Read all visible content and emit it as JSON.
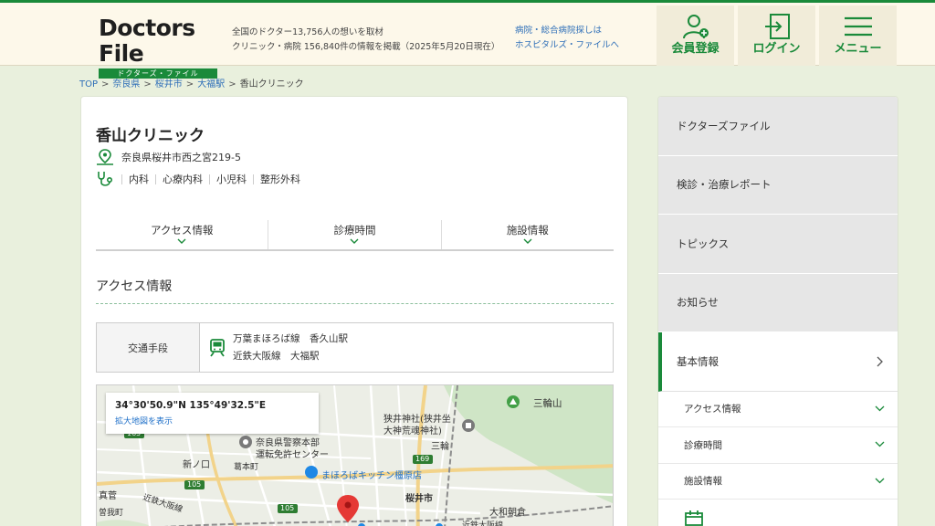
{
  "header": {
    "logo_main": "Doctors File",
    "logo_sub": "ドクターズ・ファイル",
    "tagline_1": "全国のドクター13,756人の想いを取材",
    "tagline_2": "クリニック・病院 156,840件の情報を掲載（2025年5月20日現在）",
    "hosp_link_1": "病院・総合病院探しは",
    "hosp_link_2": "ホスピタルズ・ファイルへ",
    "buttons": {
      "register": "会員登録",
      "login": "ログイン",
      "menu": "メニュー"
    }
  },
  "breadcrumb": {
    "items": [
      "TOP",
      "奈良県",
      "桜井市",
      "大福駅"
    ],
    "current": "香山クリニック",
    "sep": ">"
  },
  "clinic": {
    "name": "香山クリニック",
    "address": "奈良県桜井市西之宮219-5",
    "departments": [
      "内科",
      "心療内科",
      "小児科",
      "整形外科"
    ]
  },
  "tabs": [
    "アクセス情報",
    "診療時間",
    "施設情報"
  ],
  "access": {
    "title": "アクセス情報",
    "transport_label": "交通手段",
    "lines": [
      "万葉まほろば線　香久山駅",
      "近鉄大阪線　大福駅"
    ]
  },
  "map": {
    "coords": "34°30'50.9\"N 135°49'32.5\"E",
    "link": "拡大地図を表示",
    "labels": {
      "miwayama": "三輪山",
      "shrine_1": "狭井神社(狭井坐",
      "shrine_2": "大神荒魂神社)",
      "miwa": "三輪",
      "police_1": "奈良県警察本部",
      "police_2": "運転免許センター",
      "shinnokuchi": "新ノ口",
      "kuzumoto": "葛本町",
      "kitchen": "まほろばキッチン橿原店",
      "sakurai": "桜井市",
      "yamato_asakura": "大和朝倉",
      "kintetsu_1": "近鉄大阪線",
      "kintetsu_2": "近鉄大阪線",
      "masuga": "真菅",
      "soga": "曽我町",
      "r105a": "105",
      "r105b": "105",
      "r169": "169",
      "r165": "165"
    }
  },
  "sidebar": {
    "items": [
      "ドクターズファイル",
      "検診・治療レポート",
      "トピックス",
      "お知らせ",
      "基本情報"
    ],
    "sub_items": [
      "アクセス情報",
      "診療時間",
      "施設情報"
    ]
  },
  "colors": {
    "brand_green": "#1a8a3a",
    "link_blue": "#2f6fb8",
    "bg": "#e9f0dd",
    "pin_red": "#e53935"
  }
}
